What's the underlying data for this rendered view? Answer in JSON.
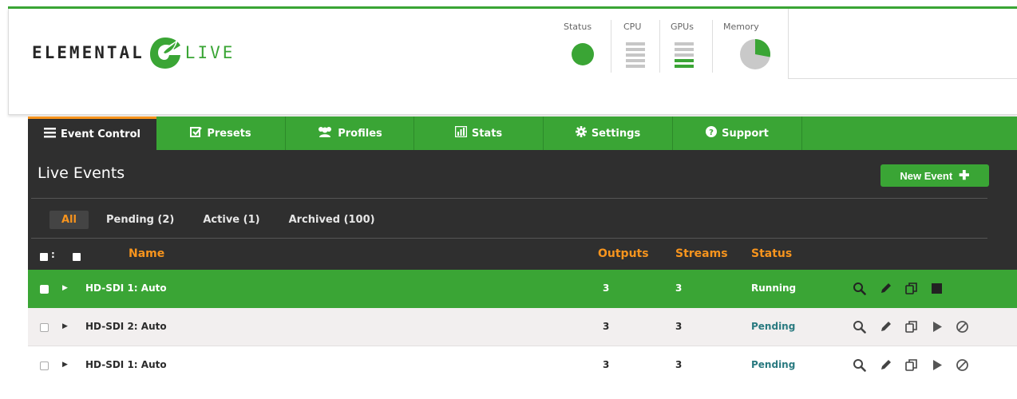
{
  "header": {
    "logo_left": "ELEMENTAL",
    "logo_right": "LIVE",
    "meters": {
      "status": "Status",
      "cpu": "CPU",
      "gpus": "GPUs",
      "memory": "Memory"
    },
    "status_color": "#3aa535",
    "cpu_level": 0,
    "gpu_level": 0.4,
    "memory_fraction": 0.28
  },
  "nav": {
    "tabs": [
      {
        "label": "Event Control",
        "icon": "list-icon"
      },
      {
        "label": "Presets",
        "icon": "checkbox-icon"
      },
      {
        "label": "Profiles",
        "icon": "users-icon"
      },
      {
        "label": "Stats",
        "icon": "bar-chart-icon"
      },
      {
        "label": "Settings",
        "icon": "gear-icon"
      },
      {
        "label": "Support",
        "icon": "question-icon"
      }
    ],
    "active": "Event Control"
  },
  "panel": {
    "title": "Live Events",
    "new_event_label": "New Event",
    "filters": [
      "All",
      "Pending (2)",
      "Active (1)",
      "Archived (100)"
    ],
    "active_filter": "All"
  },
  "table": {
    "columns": {
      "name": "Name",
      "outputs": "Outputs",
      "streams": "Streams",
      "status": "Status"
    },
    "rows": [
      {
        "name": "HD-SDI 1: Auto",
        "outputs": "3",
        "streams": "3",
        "status": "Running"
      },
      {
        "name": "HD-SDI 2: Auto",
        "outputs": "3",
        "streams": "3",
        "status": "Pending"
      },
      {
        "name": "HD-SDI 1: Auto",
        "outputs": "3",
        "streams": "3",
        "status": "Pending"
      }
    ]
  },
  "colors": {
    "brand_green": "#3aa535",
    "accent_orange": "#f7941d",
    "dark_panel": "#2f2f2f",
    "pending_teal": "#2a7a80"
  }
}
